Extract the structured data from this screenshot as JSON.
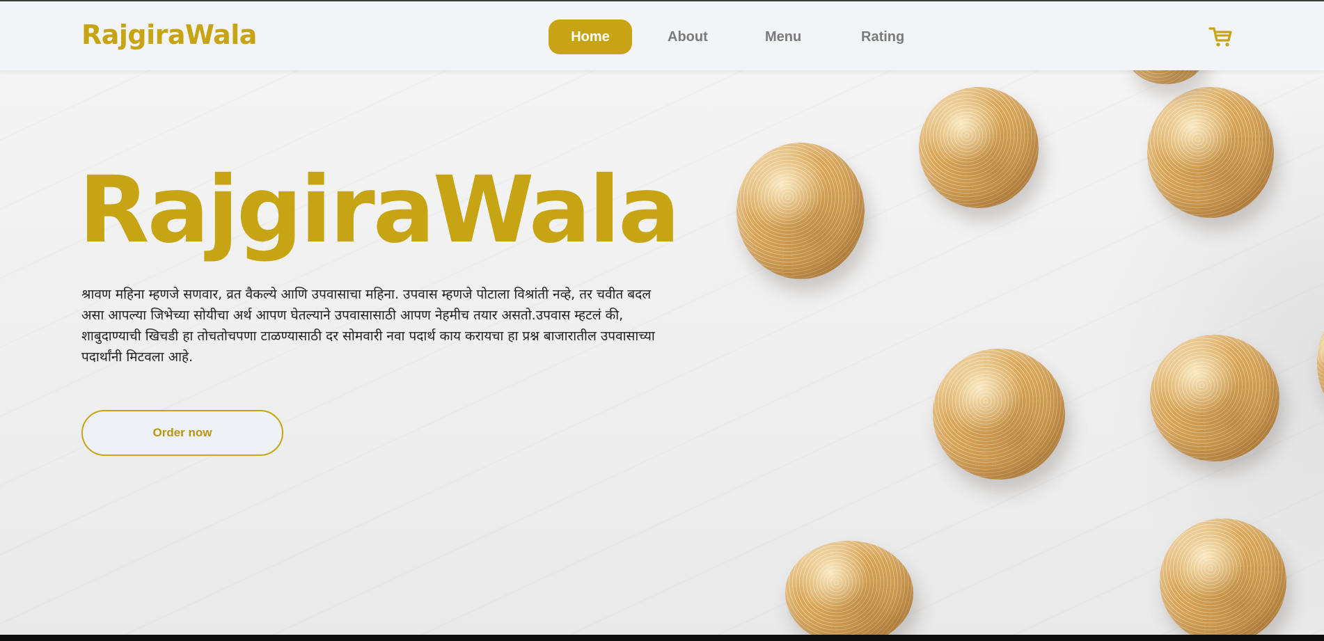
{
  "brand": {
    "name": "RajgiraWala",
    "color": "#c7a414"
  },
  "nav": {
    "items": [
      {
        "label": "Home",
        "active": true
      },
      {
        "label": "About",
        "active": false
      },
      {
        "label": "Menu",
        "active": false
      },
      {
        "label": "Rating",
        "active": false
      }
    ]
  },
  "cart": {
    "icon": "shopping-cart-icon"
  },
  "hero": {
    "title": "RajgiraWala",
    "description": "श्रावण महिना म्हणजे सणवार, व्रत वैकल्ये आणि उपवासाचा महिना. उपवास म्हणजे पोटाला विश्रांती नव्हे, तर चवीत बदल असा आपल्या जिभेच्या सोयीचा अर्थ आपण घेतल्याने उपवासासाठी आपण नेहमीच तयार असतो.उपवास म्हटलं की, शाबुदाण्याची खिचडी हा तोचतोचपणा टाळण्यासाठी दर सोमवारी नवा पदार्थ काय करायचा हा प्रश्न बाजारातील उपवासाच्या पदार्थांनी मिटवला आहे.",
    "cta_label": "Order now"
  }
}
